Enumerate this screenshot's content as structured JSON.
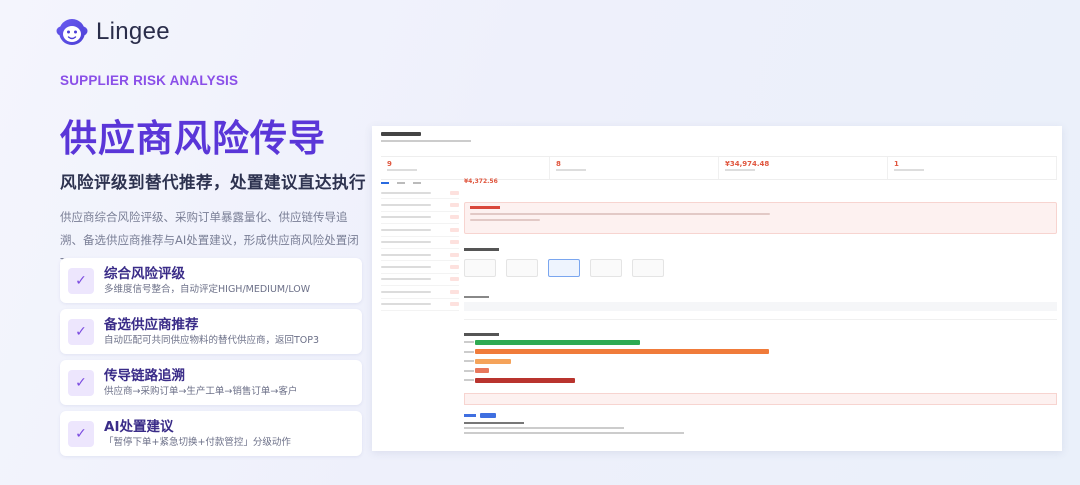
{
  "brand": {
    "name": "Lingee"
  },
  "eyebrow": "SUPPLIER RISK ANALYSIS",
  "headline": "供应商风险传导",
  "subheadline": "风险评级到替代推荐，处置建议直达执行",
  "description": "供应商综合风险评级、采购订单暴露量化、供应链传导追溯、备选供应商推荐与AI处置建议，形成供应商风险处置闭环。",
  "features": [
    {
      "title": "综合风险评级",
      "subtitle": "多维度信号整合，自动评定HIGH/MEDIUM/LOW"
    },
    {
      "title": "备选供应商推荐",
      "subtitle": "自动匹配可共同供应物料的替代供应商，返回TOP3"
    },
    {
      "title": "传导链路追溯",
      "subtitle": "供应商→采购订单→生产工单→销售订单→客户"
    },
    {
      "title": "AI处置建议",
      "subtitle": "「暂停下单+紧急切换+付款管控」分级动作"
    }
  ],
  "dashboard": {
    "kpis": [
      "9",
      "8",
      "¥34,974.48",
      "1"
    ],
    "price": "¥4,372.56",
    "colors": {
      "accent": "#5a36d8",
      "eyebrow": "#8a4fe8",
      "risk": "#e0563e"
    }
  }
}
